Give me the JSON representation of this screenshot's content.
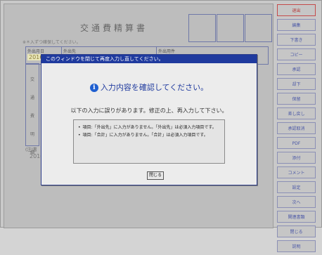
{
  "document": {
    "title": "交通費精算書",
    "note": "※＊入ずつ確保してください。",
    "date_label": "外出月日",
    "date_value": "2016/01/07",
    "dest_label": "外出先",
    "purpose_label": "外出用件",
    "side_labels": [
      "交",
      "通",
      "費",
      "明",
      "細"
    ],
    "bottom_year": "2016",
    "footer_note": "(注)書"
  },
  "toolbar": {
    "buttons": [
      "退出",
      "編集",
      "下書き",
      "コピー",
      "承認",
      "却下",
      "保留",
      "差し戻し",
      "承認取消",
      "PDF",
      "添付",
      "コメント",
      "設定",
      "次へ",
      "関連書類",
      "閉じる",
      "説明"
    ]
  },
  "dialog": {
    "titlebar": "このウィンドウを閉じて再度入力し直してください。",
    "heading": "入力内容を確認してください。",
    "message": "以下の入力に誤りがあります。修正の上、再入力して下さい。",
    "errors": [
      "項目:「外出先」に入力がありません。「外出先」は必須入力項目です。",
      "項目:「合計」に入力がありません。「合計」は必須入力項目です。"
    ],
    "close_label": "閉じる"
  },
  "colors": {
    "titlebar": "#1f3a9e",
    "heading": "#1f3a9e",
    "toolbar_text": "#4a57a6",
    "logout": "#b53333"
  }
}
